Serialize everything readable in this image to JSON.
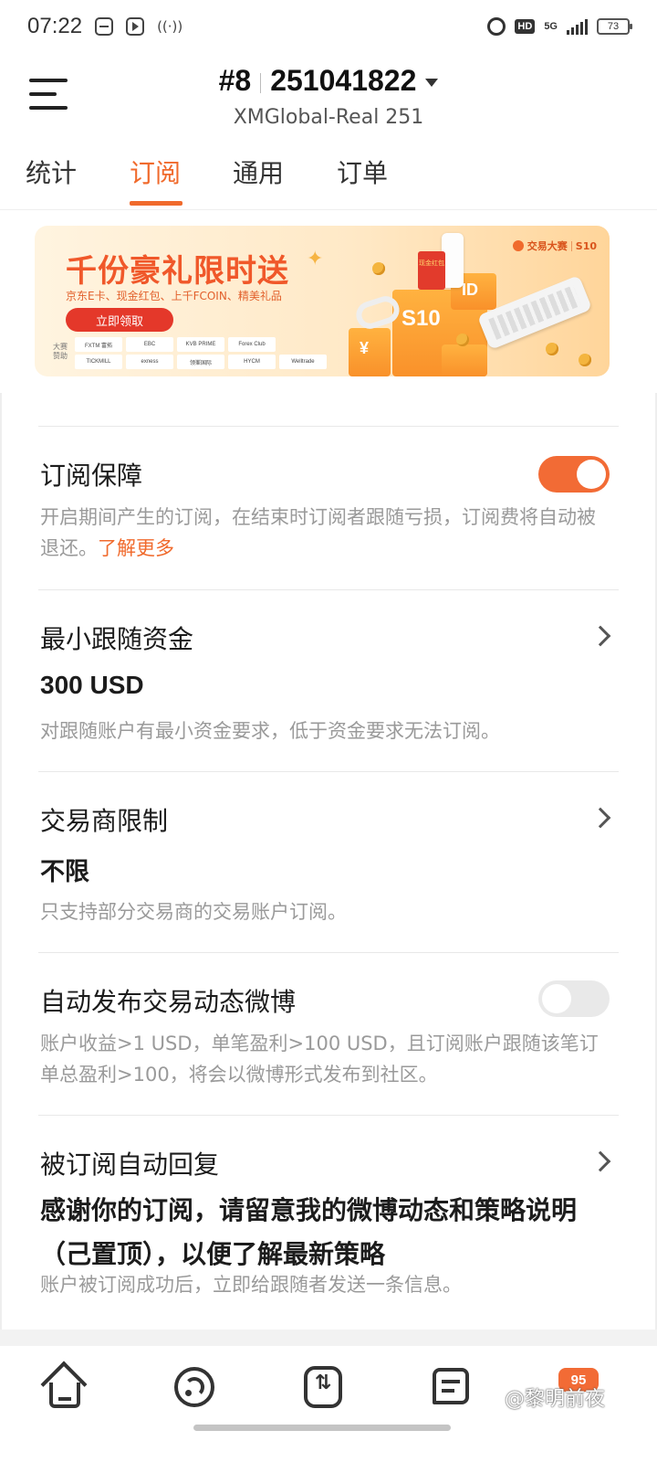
{
  "status_bar": {
    "time": "07:22",
    "network": "5G",
    "hd": "HD",
    "battery": "73"
  },
  "header": {
    "rank": "#8",
    "account_number": "251041822",
    "server": "XMGlobal-Real 251"
  },
  "tabs": [
    {
      "label": "统计",
      "active": false
    },
    {
      "label": "订阅",
      "active": true
    },
    {
      "label": "通用",
      "active": false
    },
    {
      "label": "订单",
      "active": false
    }
  ],
  "banner": {
    "headline": "千份豪礼限时送",
    "subline": "京东E卡、现金红包、上千FCOIN、精美礼品",
    "cta": "立即领取",
    "brand": "交易大赛",
    "brand_tag": "S10",
    "sponsor_label": "大赛赞助",
    "sponsors": [
      "FXTM 富拓",
      "EBC",
      "KVB PRIME",
      "Forex Club",
      "",
      "TICKMILL",
      "exness",
      "领峯国际",
      "HYCM",
      "Welltrade"
    ],
    "box_labels": [
      "S10",
      "¥",
      "ID"
    ],
    "red_card_label": "现金红包"
  },
  "settings": {
    "subscription_protection": {
      "title": "订阅保障",
      "desc": "开启期间产生的订阅，在结束时订阅者跟随亏损，订阅费将自动被退还。",
      "link": "了解更多",
      "enabled": true
    },
    "min_follow_funds": {
      "title": "最小跟随资金",
      "value": "300 USD",
      "desc": "对跟随账户有最小资金要求，低于资金要求无法订阅。"
    },
    "broker_limit": {
      "title": "交易商限制",
      "value": "不限",
      "desc": "只支持部分交易商的交易账户订阅。"
    },
    "auto_post": {
      "title": "自动发布交易动态微博",
      "desc": "账户收益>1 USD，单笔盈利>100 USD，且订阅账户跟随该笔订单总盈利>100，将会以微博形式发布到社区。",
      "enabled": false
    },
    "auto_reply": {
      "title": "被订阅自动回复",
      "value": "感谢你的订阅，请留意我的微博动态和策略说明（己置顶），以便了解最新策略",
      "desc": "账户被订阅成功后，立即给跟随者发送一条信息。"
    }
  },
  "bottom_nav": {
    "items": [
      "home-icon",
      "feed-icon",
      "trade-icon",
      "message-icon",
      "profile"
    ],
    "badge": "95",
    "watermark": "@黎明前夜"
  },
  "colors": {
    "accent": "#f06a2c",
    "toggle_on": "#f26b35",
    "desc_text": "#9a9a9a"
  }
}
